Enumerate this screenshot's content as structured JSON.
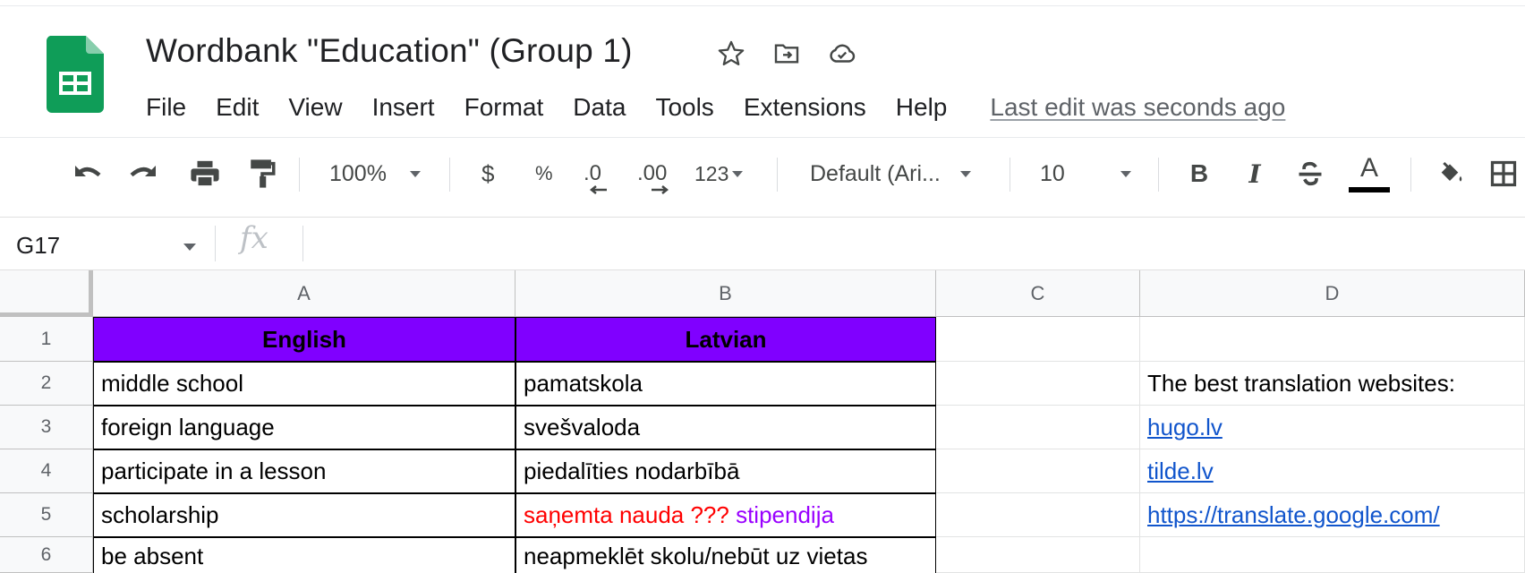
{
  "doc": {
    "title": "Wordbank \"Education\" (Group 1)"
  },
  "menu": {
    "items": [
      "File",
      "Edit",
      "View",
      "Insert",
      "Format",
      "Data",
      "Tools",
      "Extensions",
      "Help"
    ],
    "last_edit": "Last edit was seconds ago"
  },
  "toolbar": {
    "zoom": "100%",
    "currency": "$",
    "percent": "%",
    "decrease_decimal": ".0",
    "increase_decimal": ".00",
    "more_formats": "123",
    "font": "Default (Ari...",
    "font_size": "10",
    "bold": "B",
    "italic": "I",
    "text_color_letter": "A",
    "text_color": "#000000"
  },
  "formula_bar": {
    "cell_ref": "G17",
    "fx": "fx",
    "value": ""
  },
  "grid": {
    "columns": [
      "A",
      "B",
      "C",
      "D"
    ],
    "rows": [
      "1",
      "2",
      "3",
      "4",
      "5",
      "6"
    ],
    "header_fill": "#8000ff",
    "cells": {
      "A1": "English",
      "B1": "Latvian",
      "A2": "middle school",
      "B2": "pamatskola",
      "A3": "foreign language",
      "B3": "svešvaloda",
      "A4": "participate in a lesson",
      "B4": "piedalīties nodarbībā",
      "A5": "scholarship",
      "B5_red": "saņemta nauda ???",
      "B5_purple": " stipendija",
      "A6": "be absent",
      "B6": "neapmeklēt skolu/nebūt uz vietas",
      "D2": "The best translation websites:",
      "D3": "hugo.lv",
      "D4": "tilde.lv",
      "D5": "https://translate.google.com/"
    }
  },
  "colors": {
    "sheets_green": "#0f9d58",
    "link": "#1155cc",
    "red_text": "#ff0000",
    "purple_text": "#9900ff"
  }
}
